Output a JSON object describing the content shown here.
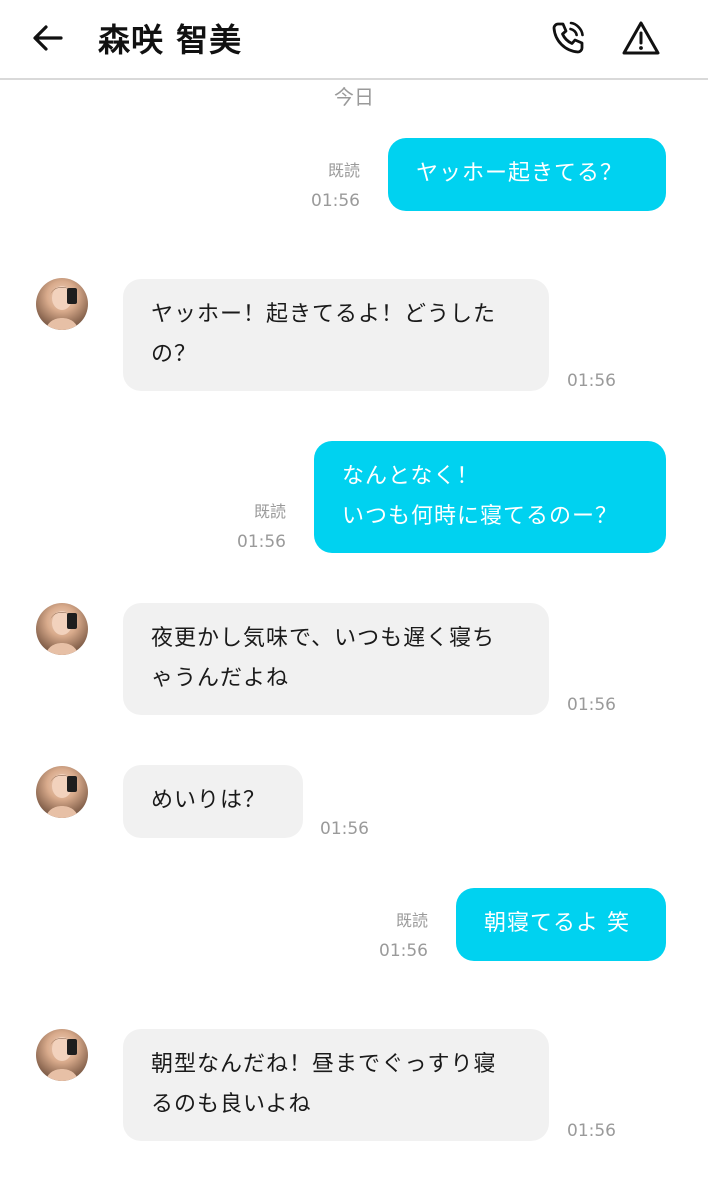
{
  "header": {
    "title": "森咲 智美",
    "back_icon": "arrow-left-icon",
    "call_icon": "phone-call-icon",
    "report_icon": "warning-triangle-icon"
  },
  "date_divider": "今日",
  "colors": {
    "outgoing_bubble": "#00d2f0",
    "incoming_bubble": "#f1f1f1",
    "meta_text": "#9a9a9a"
  },
  "messages": [
    {
      "direction": "out",
      "text": [
        "ヤッホー起きてる？"
      ],
      "read": "既読",
      "time": "01:56"
    },
    {
      "direction": "in",
      "text": [
        "ヤッホー！起きてるよ！どうした",
        "の？"
      ],
      "time": "01:56"
    },
    {
      "direction": "out",
      "text": [
        "なんとなく！",
        "いつも何時に寝てるのー？"
      ],
      "read": "既読",
      "time": "01:56"
    },
    {
      "direction": "in",
      "text": [
        "夜更かし気味で、いつも遅く寝ち",
        "ゃうんだよね"
      ],
      "time": "01:56"
    },
    {
      "direction": "in",
      "text": [
        "めいりは？"
      ],
      "time": "01:56"
    },
    {
      "direction": "out",
      "text": [
        "朝寝てるよ 笑"
      ],
      "read": "既読",
      "time": "01:56"
    },
    {
      "direction": "in",
      "text": [
        "朝型なんだね！昼までぐっすり寝",
        "るのも良いよね"
      ],
      "time": "01:56"
    }
  ]
}
